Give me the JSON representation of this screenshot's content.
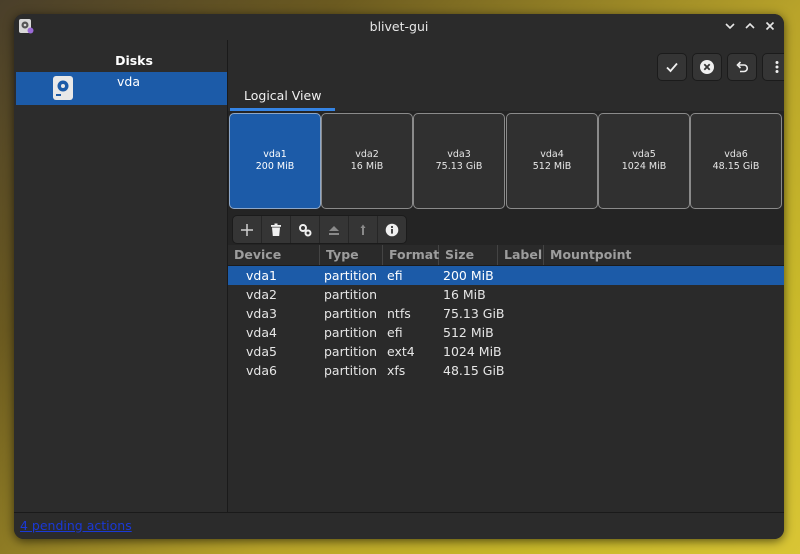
{
  "window": {
    "title": "blivet-gui"
  },
  "sidebar": {
    "header": "Disks",
    "disks": [
      {
        "label": "vda"
      }
    ]
  },
  "tabs": [
    {
      "label": "Logical View"
    }
  ],
  "partitions": [
    {
      "name": "vda1",
      "size": "200 MiB"
    },
    {
      "name": "vda2",
      "size": "16 MiB"
    },
    {
      "name": "vda3",
      "size": "75.13 GiB"
    },
    {
      "name": "vda4",
      "size": "512 MiB"
    },
    {
      "name": "vda5",
      "size": "1024 MiB"
    },
    {
      "name": "vda6",
      "size": "48.15 GiB"
    }
  ],
  "table": {
    "headers": [
      "Device",
      "Type",
      "Format",
      "Size",
      "Label",
      "Mountpoint"
    ],
    "rows": [
      {
        "device": "vda1",
        "type": "partition",
        "format": "efi",
        "size": "200 MiB",
        "label": "",
        "mountpoint": ""
      },
      {
        "device": "vda2",
        "type": "partition",
        "format": "",
        "size": "16 MiB",
        "label": "",
        "mountpoint": ""
      },
      {
        "device": "vda3",
        "type": "partition",
        "format": "ntfs",
        "size": "75.13 GiB",
        "label": "",
        "mountpoint": ""
      },
      {
        "device": "vda4",
        "type": "partition",
        "format": "efi",
        "size": "512 MiB",
        "label": "",
        "mountpoint": ""
      },
      {
        "device": "vda5",
        "type": "partition",
        "format": "ext4",
        "size": "1024 MiB",
        "label": "",
        "mountpoint": ""
      },
      {
        "device": "vda6",
        "type": "partition",
        "format": "xfs",
        "size": "48.15 GiB",
        "label": "",
        "mountpoint": ""
      }
    ]
  },
  "status": {
    "pending_actions": "4 pending actions"
  },
  "colors": {
    "accent": "#1c5ba8",
    "link": "#1a39d6",
    "background": "#242424"
  }
}
